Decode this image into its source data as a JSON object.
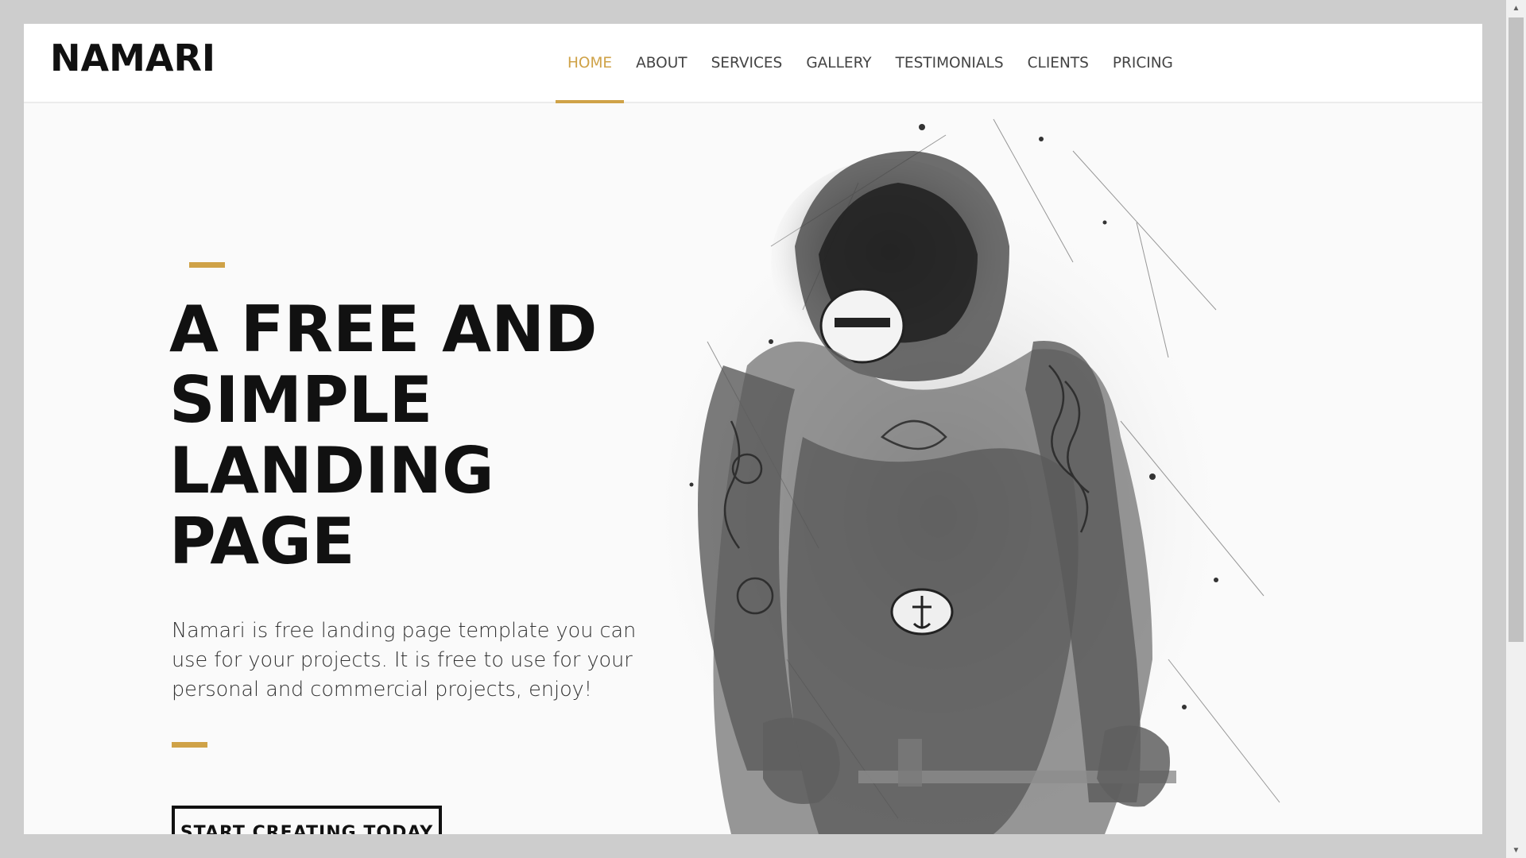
{
  "header": {
    "logo": "NAMARI",
    "nav": [
      {
        "label": "HOME",
        "active": true
      },
      {
        "label": "ABOUT",
        "active": false
      },
      {
        "label": "SERVICES",
        "active": false
      },
      {
        "label": "GALLERY",
        "active": false
      },
      {
        "label": "TESTIMONIALS",
        "active": false
      },
      {
        "label": "CLIENTS",
        "active": false
      },
      {
        "label": "PRICING",
        "active": false
      }
    ]
  },
  "hero": {
    "title": "A FREE AND SIMPLE LANDING PAGE",
    "description": "Namari is free landing page template you can use for your projects. It is free to use for your personal and commercial projects, enjoy!",
    "cta_label": "START CREATING TODAY",
    "image_subject": "ink-sketch-tattooed-cyclist-illustration"
  },
  "colors": {
    "accent": "#cfa247",
    "text": "#111111",
    "background": "#fafafa"
  }
}
